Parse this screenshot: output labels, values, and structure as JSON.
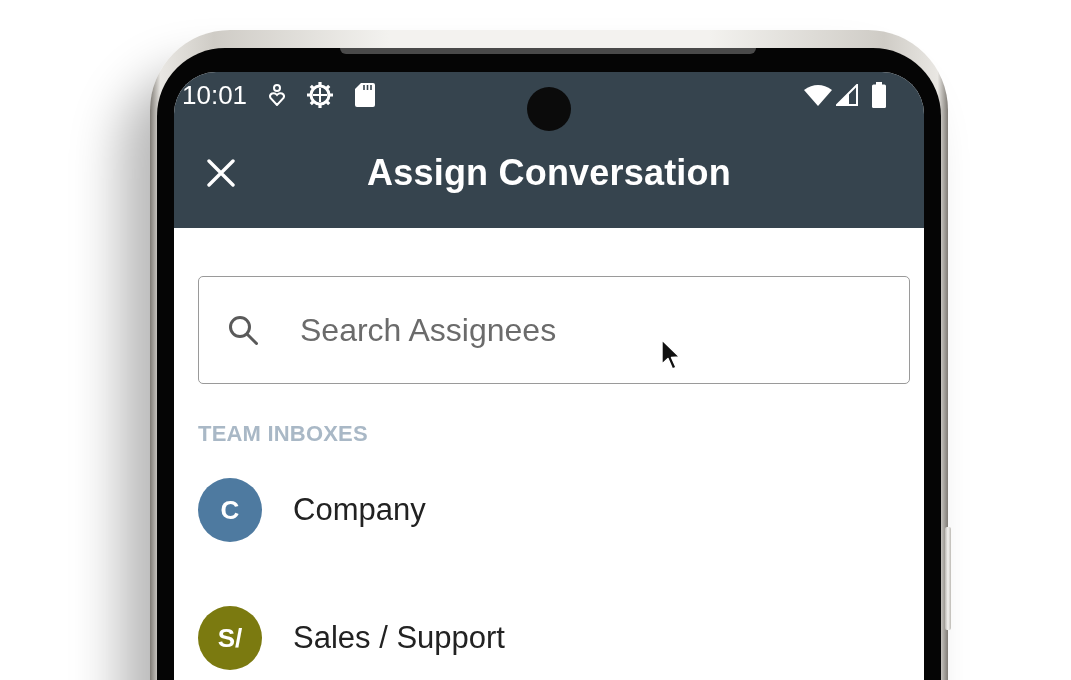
{
  "status_bar": {
    "time": "10:01"
  },
  "app_bar": {
    "title": "Assign Conversation"
  },
  "search": {
    "placeholder": "Search Assignees"
  },
  "sections": [
    {
      "heading": "TEAM INBOXES",
      "items": [
        {
          "initials": "C",
          "name": "Company",
          "color": "#4e7aa0"
        },
        {
          "initials": "S/",
          "name": "Sales / Support",
          "color": "#7b7a10"
        }
      ]
    }
  ]
}
